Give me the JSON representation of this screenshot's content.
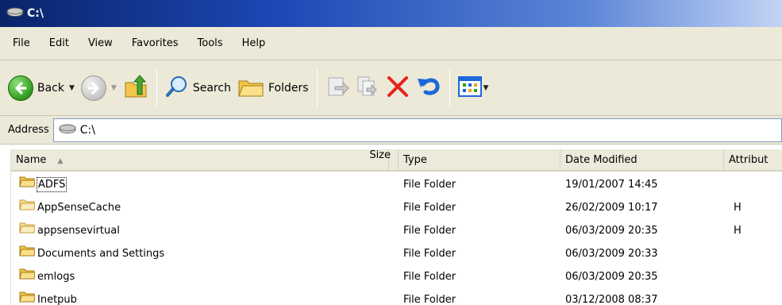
{
  "window": {
    "title": "C:\\"
  },
  "menu": {
    "items": [
      "File",
      "Edit",
      "View",
      "Favorites",
      "Tools",
      "Help"
    ]
  },
  "toolbar": {
    "back_label": "Back",
    "search_label": "Search",
    "folders_label": "Folders"
  },
  "address": {
    "label": "Address",
    "value": "C:\\"
  },
  "columns": {
    "name": "Name",
    "size": "Size",
    "type": "Type",
    "date": "Date Modified",
    "attributes": "Attribut"
  },
  "rows": [
    {
      "name": "ADFS",
      "type": "File Folder",
      "date": "19/01/2007 14:45",
      "attr": ""
    },
    {
      "name": "AppSenseCache",
      "type": "File Folder",
      "date": "26/02/2009 10:17",
      "attr": "H"
    },
    {
      "name": "appsensevirtual",
      "type": "File Folder",
      "date": "06/03/2009 20:35",
      "attr": "H"
    },
    {
      "name": "Documents and Settings",
      "type": "File Folder",
      "date": "06/03/2009 20:33",
      "attr": ""
    },
    {
      "name": "emlogs",
      "type": "File Folder",
      "date": "06/03/2009 20:35",
      "attr": ""
    },
    {
      "name": "Inetpub",
      "type": "File Folder",
      "date": "03/12/2008 08:37",
      "attr": ""
    }
  ],
  "colors": {
    "title_start": "#0a246a",
    "title_end": "#c3d4f4",
    "chrome": "#ece9d8",
    "folder": "#f3c64a",
    "delete_red": "#e8221b",
    "undo_blue": "#1d68d8"
  }
}
